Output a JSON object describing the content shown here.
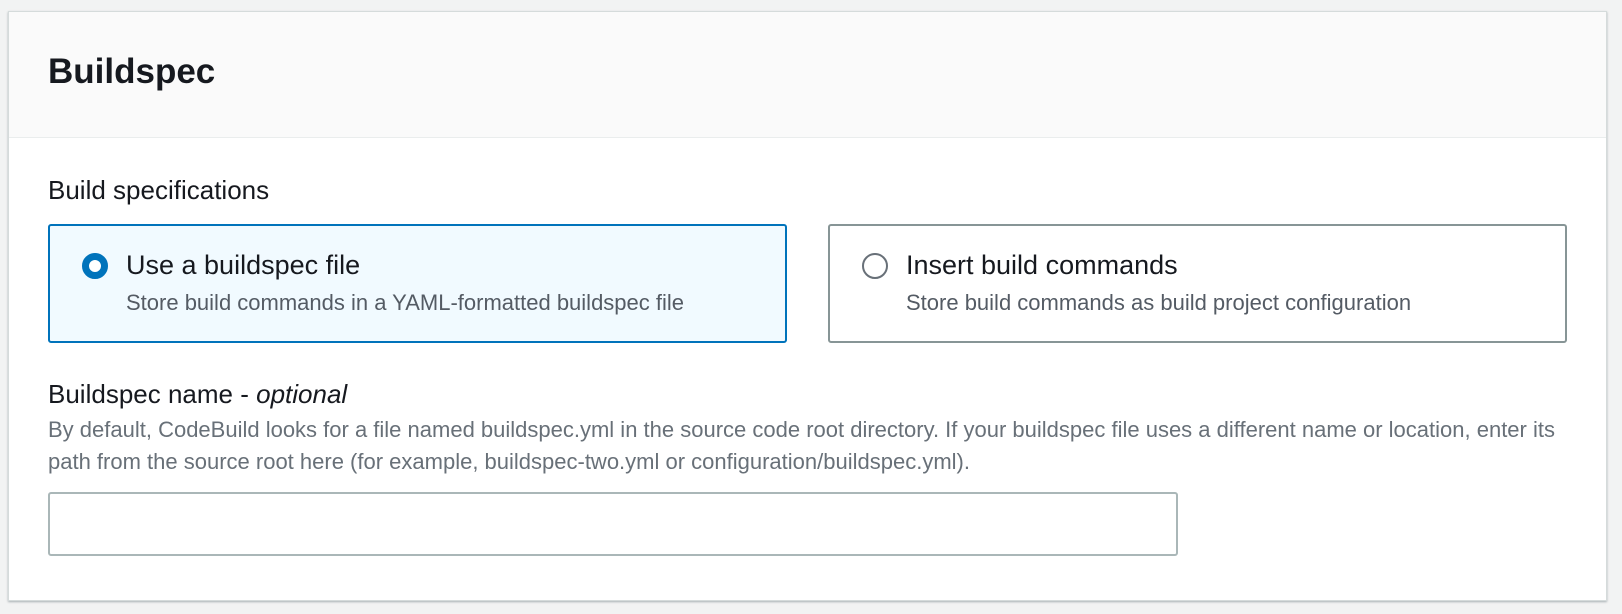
{
  "panel": {
    "title": "Buildspec"
  },
  "build_specifications": {
    "label": "Build specifications",
    "options": [
      {
        "title": "Use a buildspec file",
        "description": "Store build commands in a YAML-formatted buildspec file",
        "selected": true
      },
      {
        "title": "Insert build commands",
        "description": "Store build commands as build project configuration",
        "selected": false
      }
    ]
  },
  "buildspec_name": {
    "label": "Buildspec name - ",
    "optional": "optional",
    "description": "By default, CodeBuild looks for a file named buildspec.yml in the source code root directory. If your buildspec file uses a different name or location, enter its path from the source root here (for example, buildspec-two.yml or configuration/buildspec.yml).",
    "value": "",
    "placeholder": ""
  },
  "colors": {
    "accent": "#0073bb",
    "selected_tile_bg": "#f1faff",
    "text_secondary": "#687078"
  },
  "icons": {
    "radio_selected": "radio-checked-icon",
    "radio_unselected": "radio-unchecked-icon"
  }
}
